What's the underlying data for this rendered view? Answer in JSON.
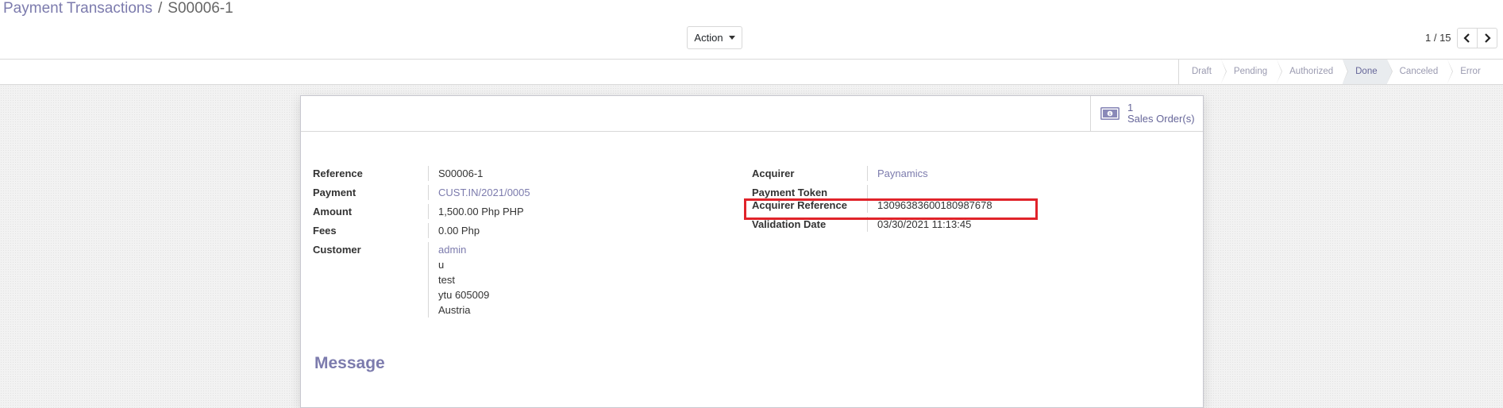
{
  "breadcrumb": {
    "parent": "Payment Transactions",
    "separator": "/",
    "current": "S00006-1"
  },
  "toolbar": {
    "action_label": "Action"
  },
  "pager": {
    "value": "1 / 15"
  },
  "statusbar": {
    "steps": [
      "Draft",
      "Pending",
      "Authorized",
      "Done",
      "Canceled",
      "Error"
    ],
    "active": "Done"
  },
  "smart_button": {
    "count": "1",
    "label": "Sales Order(s)"
  },
  "left_fields": {
    "reference": {
      "label": "Reference",
      "value": "S00006-1"
    },
    "payment": {
      "label": "Payment",
      "value": "CUST.IN/2021/0005"
    },
    "amount": {
      "label": "Amount",
      "value": "1,500.00 Php PHP"
    },
    "fees": {
      "label": "Fees",
      "value": "0.00 Php"
    },
    "customer": {
      "label": "Customer",
      "name": "admin",
      "address": [
        "u",
        "test",
        "ytu 605009",
        "Austria"
      ]
    }
  },
  "right_fields": {
    "acquirer": {
      "label": "Acquirer",
      "value": "Paynamics"
    },
    "payment_token": {
      "label": "Payment Token",
      "value": ""
    },
    "acquirer_reference": {
      "label": "Acquirer Reference",
      "value": "13096383600180987678"
    },
    "validation_date": {
      "label": "Validation Date",
      "value": "03/30/2021 11:13:45"
    }
  },
  "message": {
    "title": "Message"
  },
  "colors": {
    "accent": "#7c7bad",
    "highlight": "#e0232a",
    "active_step_bg": "#e9ecef"
  }
}
